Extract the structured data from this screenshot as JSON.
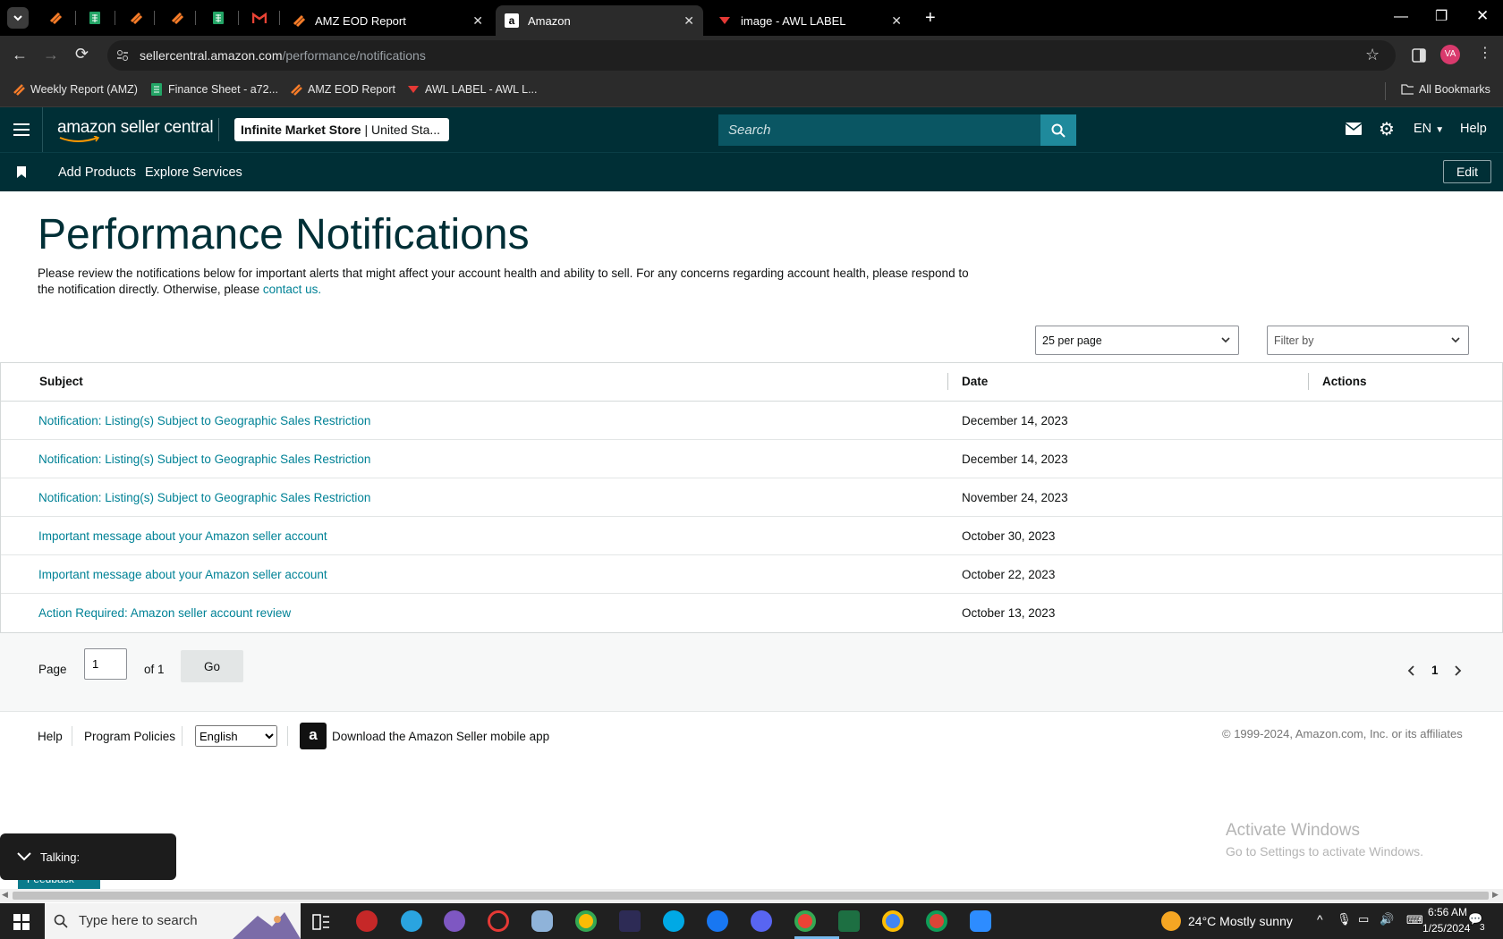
{
  "browser": {
    "tabs": [
      {
        "title": "AMZ EOD Report",
        "active": false
      },
      {
        "title": "Amazon",
        "active": true
      },
      {
        "title": "image - AWL LABEL",
        "active": false
      }
    ],
    "url_host": "sellercentral.amazon.com",
    "url_path": "/performance/notifications",
    "profile_initials": "VA",
    "bookmarks": [
      "Weekly Report (AMZ)",
      "Finance Sheet - a72...",
      "AMZ EOD Report",
      "AWL LABEL - AWL L..."
    ],
    "all_bookmarks": "All Bookmarks"
  },
  "header": {
    "logo_text": "amazon seller central",
    "store_name": "Infinite Market Store",
    "store_region": "United Sta...",
    "search_placeholder": "Search",
    "language": "EN",
    "help": "Help",
    "nav": [
      "Add Products",
      "Explore Services"
    ],
    "edit": "Edit"
  },
  "page": {
    "title": "Performance Notifications",
    "intro": "Please review the notifications below for important alerts that might affect your account health and ability to sell. For any concerns regarding account health, please respond to the notification directly. Otherwise, please",
    "contact_link": "contact us.",
    "per_page": "25 per page",
    "filter": "Filter by"
  },
  "table": {
    "columns": [
      "Subject",
      "Date",
      "Actions"
    ],
    "rows": [
      {
        "subject": "Notification: Listing(s) Subject to Geographic Sales Restriction",
        "date": "December 14, 2023"
      },
      {
        "subject": "Notification: Listing(s) Subject to Geographic Sales Restriction",
        "date": "December 14, 2023"
      },
      {
        "subject": "Notification: Listing(s) Subject to Geographic Sales Restriction",
        "date": "November 24, 2023"
      },
      {
        "subject": "Important message about your Amazon seller account",
        "date": "October 30, 2023"
      },
      {
        "subject": "Important message about your Amazon seller account",
        "date": "October 22, 2023"
      },
      {
        "subject": "Action Required: Amazon seller account review",
        "date": "October 13, 2023"
      }
    ]
  },
  "pager": {
    "page_label": "Page",
    "page_value": "1",
    "of_label": "of 1",
    "go": "Go",
    "current": "1"
  },
  "footer": {
    "help": "Help",
    "policies": "Program Policies",
    "language": "English",
    "app_text": "Download the Amazon Seller mobile app",
    "copyright": "© 1999-2024, Amazon.com, Inc. or its affiliates"
  },
  "overlay": {
    "activate_title": "Activate Windows",
    "activate_sub": "Go to Settings to activate Windows.",
    "talking": "Talking:",
    "feedback": "Feedback"
  },
  "taskbar": {
    "search_placeholder": "Type here to search",
    "weather": "24°C  Mostly sunny",
    "time": "6:56 AM",
    "date": "1/25/2024",
    "notif_count": "3"
  },
  "colors": {
    "header_bg": "#002f36",
    "link": "#008296",
    "search_btn": "#1f8a9c"
  }
}
